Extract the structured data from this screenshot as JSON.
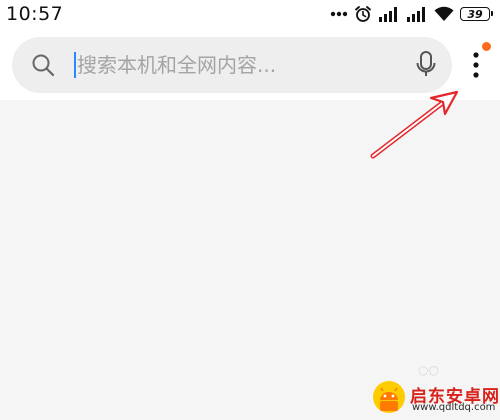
{
  "status_bar": {
    "time": "10:57",
    "battery_level": "39",
    "icons": [
      "more-dots-icon",
      "alarm-icon",
      "signal-icon",
      "signal-icon-2",
      "wifi-icon",
      "battery-icon"
    ]
  },
  "search": {
    "placeholder": "搜索本机和全网内容...",
    "icon": "search-icon",
    "voice_icon": "microphone-icon"
  },
  "menu": {
    "icon": "more-vertical-icon",
    "has_notification": true,
    "notification_color": "#ff6a1a"
  },
  "annotation": {
    "type": "arrow",
    "color": "#e5262a"
  },
  "watermark": {
    "title": "启东安卓网",
    "url": "www.qdltdq.com",
    "logo_icon": "android-robot-logo"
  },
  "colors": {
    "caret": "#2b86ff",
    "page_background": "#f5f5f5",
    "search_background": "#eeeeee",
    "watermark_red": "#d8231c"
  }
}
